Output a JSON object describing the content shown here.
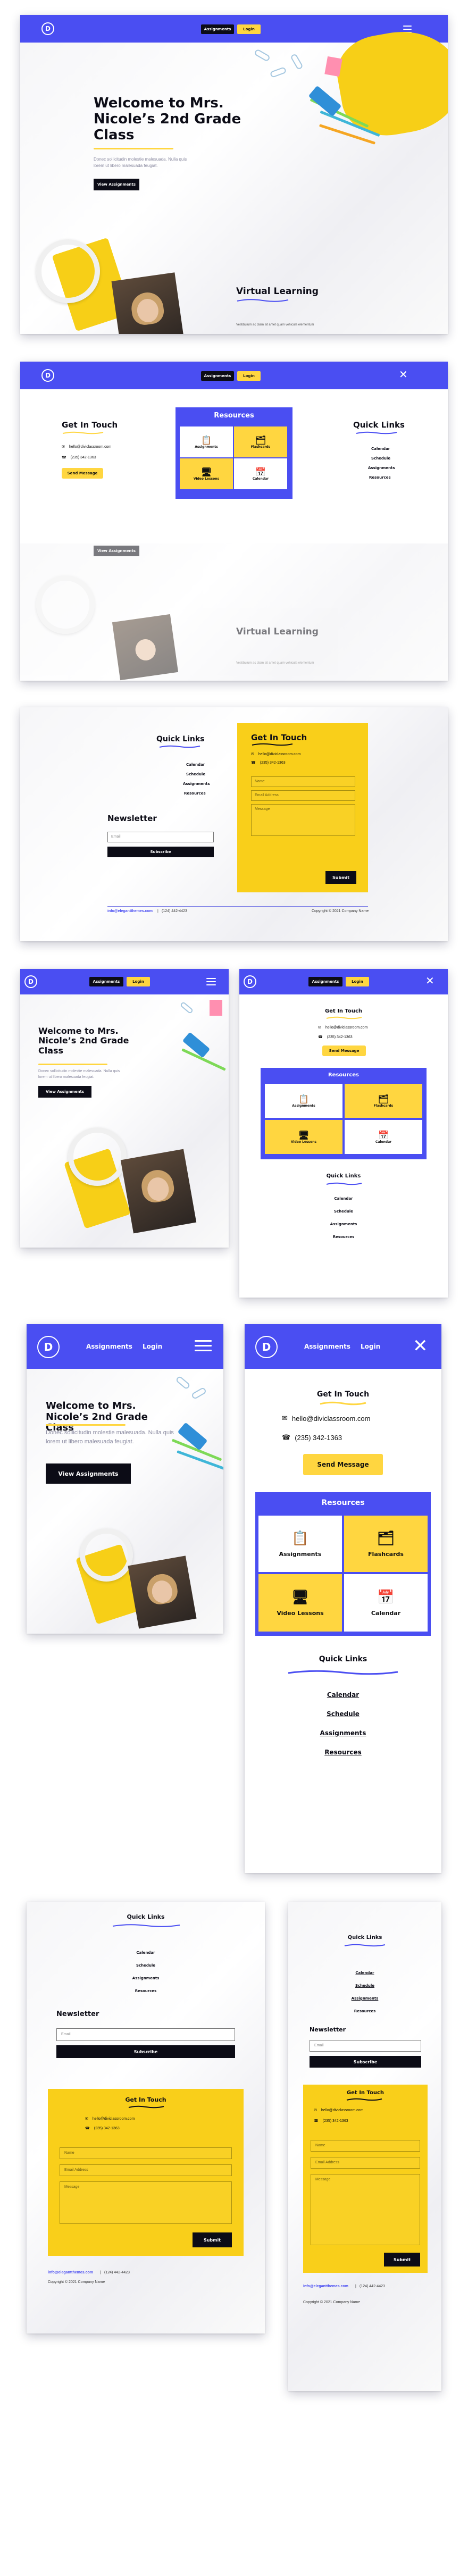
{
  "nav": {
    "assignments": "Assignments",
    "login": "Login"
  },
  "logo_letter": "D",
  "hero": {
    "title_line1": "Welcome to Mrs.",
    "title_line2": "Nicole’s 2nd Grade",
    "title_line3": "Class",
    "subtitle_line1": "Donec sollicitudin molestie malesuada. Nulla quis",
    "subtitle_line2": "lorem ut libero malesuada feugiat.",
    "cta": "View Assignments"
  },
  "virtual": {
    "title": "Virtual Learning",
    "text": "Vestibulum ac diam sit amet quam vehicula elementum"
  },
  "contact": {
    "title": "Get In Touch",
    "email": "hello@diviclassroom.com",
    "phone": "(235) 342-1363",
    "send": "Send Message",
    "name_placeholder": "Name",
    "email_placeholder": "Email Address",
    "message_placeholder": "Message",
    "submit": "Submit"
  },
  "resources": {
    "title": "Resources",
    "items": [
      {
        "label": "Assignments",
        "icon": "clipboard-icon"
      },
      {
        "label": "Flashcards",
        "icon": "cards-icon"
      },
      {
        "label": "Video Lessons",
        "icon": "monitor-icon"
      },
      {
        "label": "Calendar",
        "icon": "calendar-icon"
      }
    ]
  },
  "quick_links": {
    "title": "Quick Links",
    "items": [
      "Calendar",
      "Schedule",
      "Assignments",
      "Resources"
    ]
  },
  "newsletter": {
    "title": "Newsletter",
    "email_placeholder": "Email",
    "subscribe": "Subscribe"
  },
  "footer": {
    "link": "info@elegantthemes.com",
    "sep": "|",
    "phone": "(124) 442-4423",
    "copyright": "Copyright © 2021 Company Name"
  },
  "colors": {
    "brand_blue": "#4a4ef2",
    "accent_yellow": "#ffd640",
    "dark": "#0c0c16"
  }
}
